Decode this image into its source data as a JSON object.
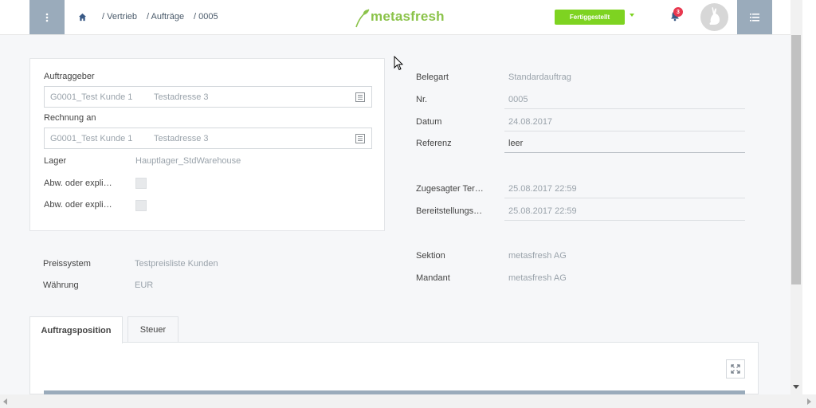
{
  "header": {
    "breadcrumbs": [
      "/ Vertrieb",
      "/ Aufträge",
      "/ 0005"
    ],
    "logo_text": "metasfresh",
    "status_label": "Fertiggestellt",
    "notification_count": "3",
    "accent_color": "#7ed321",
    "nav_color": "#9aabbb"
  },
  "left_panel": {
    "auftraggeber_label": "Auftraggeber",
    "auftraggeber_partner": "G0001_Test Kunde 1",
    "auftraggeber_address": "Testadresse 3",
    "rechnung_label": "Rechnung an",
    "rechnung_partner": "G0001_Test Kunde 1",
    "rechnung_address": "Testadresse 3",
    "lager_label": "Lager",
    "lager_value": "Hauptlager_StdWarehouse",
    "abw1_label": "Abw. oder expli…",
    "abw2_label": "Abw. oder expli…"
  },
  "lower_left": {
    "preissystem_label": "Preissystem",
    "preissystem_value": "Testpreisliste Kunden",
    "waehrung_label": "Währung",
    "waehrung_value": "EUR"
  },
  "right_panel": {
    "belegart_label": "Belegart",
    "belegart_value": "Standardauftrag",
    "nr_label": "Nr.",
    "nr_value": "0005",
    "datum_label": "Datum",
    "datum_value": "24.08.2017",
    "referenz_label": "Referenz",
    "referenz_value": "leer",
    "zugesagt_label": "Zugesagter Ter…",
    "zugesagt_value": "25.08.2017 22:59",
    "bereit_label": "Bereitstellungs…",
    "bereit_value": "25.08.2017 22:59",
    "sektion_label": "Sektion",
    "sektion_value": "metasfresh AG",
    "mandant_label": "Mandant",
    "mandant_value": "metasfresh AG"
  },
  "tabs": [
    {
      "label": "Auftragsposition"
    },
    {
      "label": "Steuer"
    }
  ]
}
